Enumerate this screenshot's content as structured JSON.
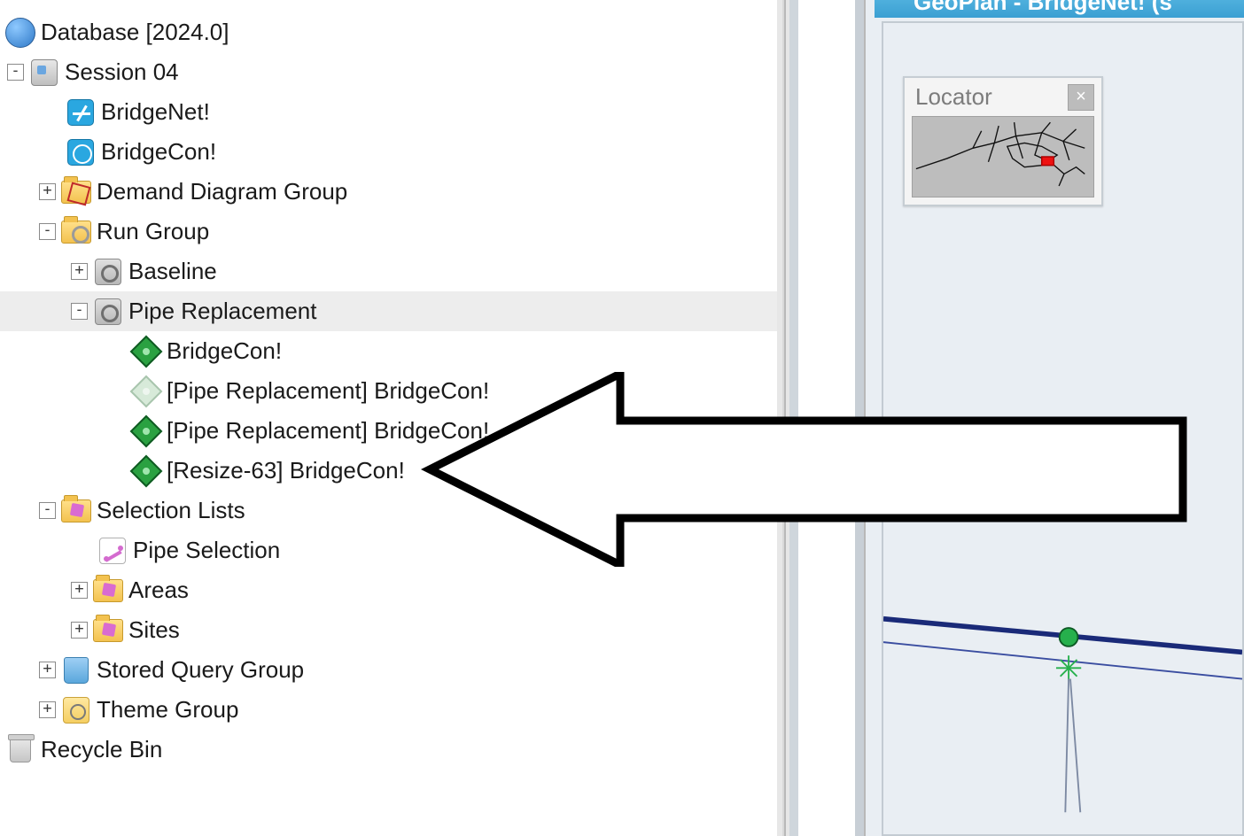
{
  "right_title": "GeoPlan - BridgeNet! (s",
  "locator": {
    "title": "Locator",
    "close": "×"
  },
  "tree": {
    "root": {
      "label": "Database [2024.0]"
    },
    "session": {
      "label": "Session 04"
    },
    "bridgenet": {
      "label": "BridgeNet!"
    },
    "bridgecon": {
      "label": "BridgeCon!"
    },
    "demand": {
      "label": "Demand Diagram Group"
    },
    "rungroup": {
      "label": "Run Group"
    },
    "baseline": {
      "label": "Baseline"
    },
    "pipereplace": {
      "label": "Pipe Replacement"
    },
    "pr_bc": {
      "label": "BridgeCon!"
    },
    "pr_bc_pr1": {
      "label": "[Pipe Replacement] BridgeCon!"
    },
    "pr_bc_pr2": {
      "label": "[Pipe Replacement] BridgeCon!"
    },
    "pr_resize": {
      "label": "[Resize-63] BridgeCon!"
    },
    "sellists": {
      "label": "Selection Lists"
    },
    "pipesel": {
      "label": "Pipe Selection"
    },
    "areas": {
      "label": "Areas"
    },
    "sites": {
      "label": "Sites"
    },
    "storedq": {
      "label": "Stored Query Group"
    },
    "themegrp": {
      "label": "Theme Group"
    },
    "recycle": {
      "label": "Recycle Bin"
    }
  }
}
